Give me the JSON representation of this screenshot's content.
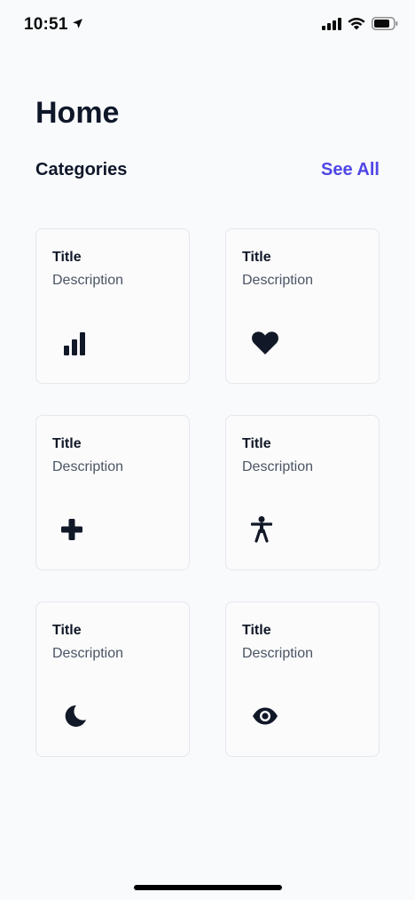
{
  "status_bar": {
    "time": "10:51"
  },
  "header": {
    "title": "Home"
  },
  "section": {
    "title": "Categories",
    "see_all_label": "See All"
  },
  "colors": {
    "accent": "#4f46e5",
    "text": "#0f172a",
    "icon": "#111827"
  },
  "cards": [
    {
      "title": "Title",
      "description": "Description",
      "icon": "bar-chart-icon"
    },
    {
      "title": "Title",
      "description": "Description",
      "icon": "heart-icon"
    },
    {
      "title": "Title",
      "description": "Description",
      "icon": "plus-icon"
    },
    {
      "title": "Title",
      "description": "Description",
      "icon": "accessibility-icon"
    },
    {
      "title": "Title",
      "description": "Description",
      "icon": "moon-icon"
    },
    {
      "title": "Title",
      "description": "Description",
      "icon": "eye-icon"
    }
  ]
}
